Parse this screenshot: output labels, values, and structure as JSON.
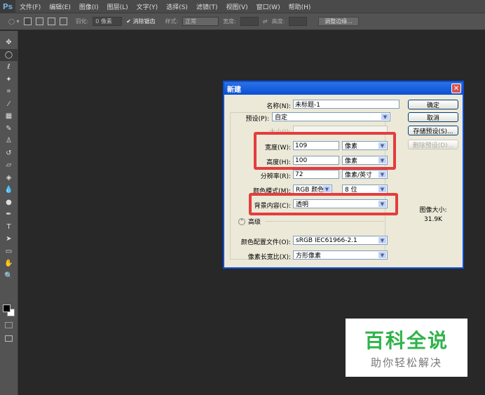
{
  "app": {
    "logo": "Ps"
  },
  "menu": [
    "文件(F)",
    "编辑(E)",
    "图像(I)",
    "图层(L)",
    "文字(Y)",
    "选择(S)",
    "滤镜(T)",
    "视图(V)",
    "窗口(W)",
    "帮助(H)"
  ],
  "options": {
    "feather_label": "羽化:",
    "feather_value": "0 像素",
    "antialias_label": "消除锯齿",
    "style_label": "样式:",
    "style_value": "正常",
    "width_label": "宽度:",
    "height_label": "高度:",
    "refine_edge": "调整边缘..."
  },
  "tools": [
    {
      "name": "move",
      "glyph": "✥"
    },
    {
      "name": "elliptical-marquee",
      "glyph": "◯"
    },
    {
      "name": "lasso",
      "glyph": "ℓ"
    },
    {
      "name": "magic-wand",
      "glyph": "✦"
    },
    {
      "name": "crop",
      "glyph": "⌗"
    },
    {
      "name": "eyedropper",
      "glyph": "⁄"
    },
    {
      "name": "healing-brush",
      "glyph": "▦"
    },
    {
      "name": "brush",
      "glyph": "✎"
    },
    {
      "name": "clone-stamp",
      "glyph": "♙"
    },
    {
      "name": "history-brush",
      "glyph": "↺"
    },
    {
      "name": "eraser",
      "glyph": "▱"
    },
    {
      "name": "paint-bucket",
      "glyph": "◈"
    },
    {
      "name": "blur",
      "glyph": "💧"
    },
    {
      "name": "dodge",
      "glyph": "●"
    },
    {
      "name": "pen",
      "glyph": "✒"
    },
    {
      "name": "type",
      "glyph": "T"
    },
    {
      "name": "path-selection",
      "glyph": "➤"
    },
    {
      "name": "rectangle",
      "glyph": "▭"
    },
    {
      "name": "hand",
      "glyph": "✋"
    },
    {
      "name": "zoom",
      "glyph": "🔍"
    }
  ],
  "dialog": {
    "title": "新建",
    "name_label": "名称(N):",
    "name_value": "未标题-1",
    "preset_label": "预设(P):",
    "preset_value": "自定",
    "size_label": "大小(I):",
    "width_label": "宽度(W):",
    "width_value": "109",
    "width_unit": "像素",
    "height_label": "高度(H):",
    "height_value": "100",
    "height_unit": "像素",
    "resolution_label": "分辨率(R):",
    "resolution_value": "72",
    "resolution_unit": "像素/英寸",
    "color_mode_label": "颜色模式(M):",
    "color_mode_value": "RGB 颜色",
    "bit_depth": "8 位",
    "background_label": "背景内容(C):",
    "background_value": "透明",
    "advanced_label": "高级",
    "color_profile_label": "颜色配置文件(O):",
    "color_profile_value": "sRGB IEC61966-2.1",
    "pixel_aspect_label": "像素长宽比(X):",
    "pixel_aspect_value": "方形像素",
    "ok": "确定",
    "cancel": "取消",
    "save_preset": "存储预设(S)...",
    "delete_preset": "删除预设(D)...",
    "image_size_label": "图像大小:",
    "image_size_value": "31.9K"
  },
  "watermark": {
    "title": "百科全说",
    "subtitle": "助你轻松解决"
  }
}
